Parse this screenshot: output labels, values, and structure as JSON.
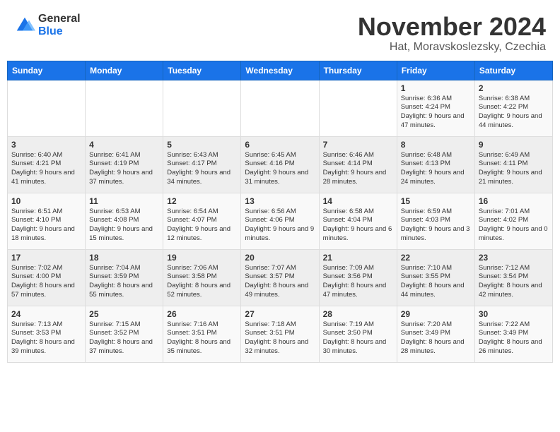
{
  "logo": {
    "general": "General",
    "blue": "Blue"
  },
  "title": {
    "month": "November 2024",
    "location": "Hat, Moravskoslezsky, Czechia"
  },
  "headers": [
    "Sunday",
    "Monday",
    "Tuesday",
    "Wednesday",
    "Thursday",
    "Friday",
    "Saturday"
  ],
  "weeks": [
    [
      {
        "day": "",
        "info": ""
      },
      {
        "day": "",
        "info": ""
      },
      {
        "day": "",
        "info": ""
      },
      {
        "day": "",
        "info": ""
      },
      {
        "day": "",
        "info": ""
      },
      {
        "day": "1",
        "info": "Sunrise: 6:36 AM\nSunset: 4:24 PM\nDaylight: 9 hours and 47 minutes."
      },
      {
        "day": "2",
        "info": "Sunrise: 6:38 AM\nSunset: 4:22 PM\nDaylight: 9 hours and 44 minutes."
      }
    ],
    [
      {
        "day": "3",
        "info": "Sunrise: 6:40 AM\nSunset: 4:21 PM\nDaylight: 9 hours and 41 minutes."
      },
      {
        "day": "4",
        "info": "Sunrise: 6:41 AM\nSunset: 4:19 PM\nDaylight: 9 hours and 37 minutes."
      },
      {
        "day": "5",
        "info": "Sunrise: 6:43 AM\nSunset: 4:17 PM\nDaylight: 9 hours and 34 minutes."
      },
      {
        "day": "6",
        "info": "Sunrise: 6:45 AM\nSunset: 4:16 PM\nDaylight: 9 hours and 31 minutes."
      },
      {
        "day": "7",
        "info": "Sunrise: 6:46 AM\nSunset: 4:14 PM\nDaylight: 9 hours and 28 minutes."
      },
      {
        "day": "8",
        "info": "Sunrise: 6:48 AM\nSunset: 4:13 PM\nDaylight: 9 hours and 24 minutes."
      },
      {
        "day": "9",
        "info": "Sunrise: 6:49 AM\nSunset: 4:11 PM\nDaylight: 9 hours and 21 minutes."
      }
    ],
    [
      {
        "day": "10",
        "info": "Sunrise: 6:51 AM\nSunset: 4:10 PM\nDaylight: 9 hours and 18 minutes."
      },
      {
        "day": "11",
        "info": "Sunrise: 6:53 AM\nSunset: 4:08 PM\nDaylight: 9 hours and 15 minutes."
      },
      {
        "day": "12",
        "info": "Sunrise: 6:54 AM\nSunset: 4:07 PM\nDaylight: 9 hours and 12 minutes."
      },
      {
        "day": "13",
        "info": "Sunrise: 6:56 AM\nSunset: 4:06 PM\nDaylight: 9 hours and 9 minutes."
      },
      {
        "day": "14",
        "info": "Sunrise: 6:58 AM\nSunset: 4:04 PM\nDaylight: 9 hours and 6 minutes."
      },
      {
        "day": "15",
        "info": "Sunrise: 6:59 AM\nSunset: 4:03 PM\nDaylight: 9 hours and 3 minutes."
      },
      {
        "day": "16",
        "info": "Sunrise: 7:01 AM\nSunset: 4:02 PM\nDaylight: 9 hours and 0 minutes."
      }
    ],
    [
      {
        "day": "17",
        "info": "Sunrise: 7:02 AM\nSunset: 4:00 PM\nDaylight: 8 hours and 57 minutes."
      },
      {
        "day": "18",
        "info": "Sunrise: 7:04 AM\nSunset: 3:59 PM\nDaylight: 8 hours and 55 minutes."
      },
      {
        "day": "19",
        "info": "Sunrise: 7:06 AM\nSunset: 3:58 PM\nDaylight: 8 hours and 52 minutes."
      },
      {
        "day": "20",
        "info": "Sunrise: 7:07 AM\nSunset: 3:57 PM\nDaylight: 8 hours and 49 minutes."
      },
      {
        "day": "21",
        "info": "Sunrise: 7:09 AM\nSunset: 3:56 PM\nDaylight: 8 hours and 47 minutes."
      },
      {
        "day": "22",
        "info": "Sunrise: 7:10 AM\nSunset: 3:55 PM\nDaylight: 8 hours and 44 minutes."
      },
      {
        "day": "23",
        "info": "Sunrise: 7:12 AM\nSunset: 3:54 PM\nDaylight: 8 hours and 42 minutes."
      }
    ],
    [
      {
        "day": "24",
        "info": "Sunrise: 7:13 AM\nSunset: 3:53 PM\nDaylight: 8 hours and 39 minutes."
      },
      {
        "day": "25",
        "info": "Sunrise: 7:15 AM\nSunset: 3:52 PM\nDaylight: 8 hours and 37 minutes."
      },
      {
        "day": "26",
        "info": "Sunrise: 7:16 AM\nSunset: 3:51 PM\nDaylight: 8 hours and 35 minutes."
      },
      {
        "day": "27",
        "info": "Sunrise: 7:18 AM\nSunset: 3:51 PM\nDaylight: 8 hours and 32 minutes."
      },
      {
        "day": "28",
        "info": "Sunrise: 7:19 AM\nSunset: 3:50 PM\nDaylight: 8 hours and 30 minutes."
      },
      {
        "day": "29",
        "info": "Sunrise: 7:20 AM\nSunset: 3:49 PM\nDaylight: 8 hours and 28 minutes."
      },
      {
        "day": "30",
        "info": "Sunrise: 7:22 AM\nSunset: 3:49 PM\nDaylight: 8 hours and 26 minutes."
      }
    ]
  ]
}
